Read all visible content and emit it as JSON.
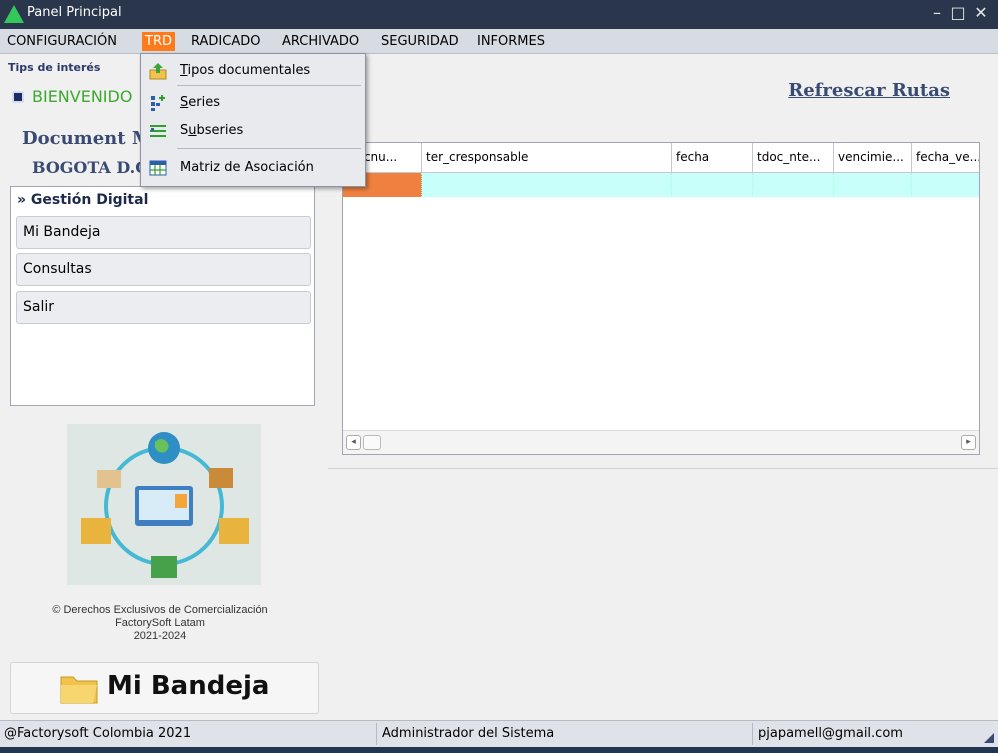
{
  "window": {
    "title": "Panel Principal"
  },
  "menubar": {
    "items": [
      {
        "label": "CONFIGURACIÓN"
      },
      {
        "label": "TRD"
      },
      {
        "label": "RADICADO"
      },
      {
        "label": "ARCHIVADO"
      },
      {
        "label": "SEGURIDAD"
      },
      {
        "label": "INFORMES"
      }
    ]
  },
  "trd_menu": {
    "items": [
      {
        "mnemonic": "T",
        "rest": "ipos documentales",
        "icon": "document-upload-icon"
      },
      {
        "mnemonic": "S",
        "rest": "eries",
        "icon": "tree-add-icon"
      },
      {
        "mnemonic": "u",
        "prefix": "S",
        "rest": "bseries",
        "icon": "list-add-icon"
      },
      {
        "mnemonic": "",
        "rest": "Matriz de Asociación",
        "icon": "grid-table-icon"
      }
    ]
  },
  "header": {
    "tips_label": "Tips de interés",
    "bienvenido": "BIENVENIDO",
    "refrescar": "Refrescar Rutas",
    "doc_title": "Document M",
    "doc_sub": "BOGOTA D.C"
  },
  "sidebar": {
    "group_label": "Gestión Digital",
    "buttons": [
      {
        "label": "Mi Bandeja"
      },
      {
        "label": "Consultas"
      },
      {
        "label": "Salir"
      }
    ]
  },
  "rights": {
    "line1": "Derechos Exclusivos de Comercialización",
    "line2": "FactorySoft Latam",
    "line3": "2021-2024"
  },
  "big_button": {
    "label": "Mi Bandeja"
  },
  "grid": {
    "columns": [
      "di_cnu...",
      "ter_cresponsable",
      "fecha",
      "tdoc_nte...",
      "vencimie...",
      "fecha_ve..."
    ]
  },
  "status": {
    "left": "@Factorysoft Colombia 2021",
    "middle": "Administrador del Sistema",
    "right": "pjapamell@gmail.com"
  },
  "colors": {
    "accent": "#ff7a1a",
    "row_highlight": "#c8fffb",
    "title_bar": "#29364b"
  }
}
